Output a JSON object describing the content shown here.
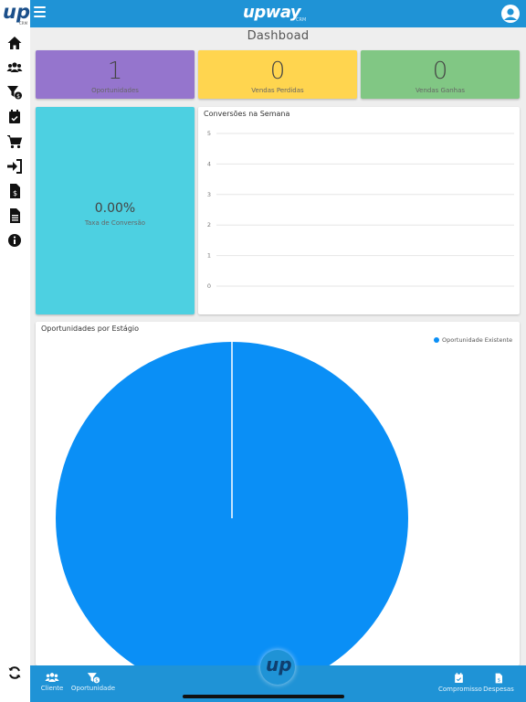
{
  "header": {
    "brand_name": "upway",
    "brand_sub": "CRM",
    "logo_text": "up",
    "logo_sub": "CRM"
  },
  "page": {
    "title": "Dashboad"
  },
  "kpis": [
    {
      "value": "1",
      "label": "Oportunidades",
      "color": "#9575cd"
    },
    {
      "value": "0",
      "label": "Vendas Perdidas",
      "color": "#ffd54f"
    },
    {
      "value": "0",
      "label": "Vendas Ganhas",
      "color": "#81c784"
    }
  ],
  "conversion": {
    "value": "0.00%",
    "label": "Taxa de Conversão",
    "color": "#4dd0e1"
  },
  "weekly_chart": {
    "title": "Conversões na Semana",
    "chart_data": {
      "type": "line",
      "title": "Conversões na Semana",
      "y_ticks": [
        "5",
        "4",
        "3",
        "2",
        "1",
        "0"
      ],
      "ylim": [
        0,
        5
      ],
      "grid": true,
      "series": []
    }
  },
  "stage_chart": {
    "title": "Oportunidades por Estágio",
    "legend": "Oportunidade Existente",
    "chart_data": {
      "type": "pie",
      "title": "Oportunidades por Estágio",
      "categories": [
        "Oportunidade Existente"
      ],
      "values": [
        1
      ],
      "colors": [
        "#0a8ff6"
      ],
      "legend_position": "top-right"
    }
  },
  "sidebar": {
    "icons": [
      "home-icon",
      "users-icon",
      "funnel-dollar-icon",
      "calendar-check-icon",
      "cart-icon",
      "sign-in-icon",
      "dollar-file-icon",
      "document-icon",
      "info-icon"
    ]
  },
  "bottom_nav": {
    "cliente": "Cliente",
    "oportunidade": "Oportunidade",
    "compromisso": "Compromisso",
    "despesas": "Despesas",
    "fab_text": "up"
  },
  "colors": {
    "primary": "#1f93d6",
    "pie": "#0a8ff6"
  }
}
